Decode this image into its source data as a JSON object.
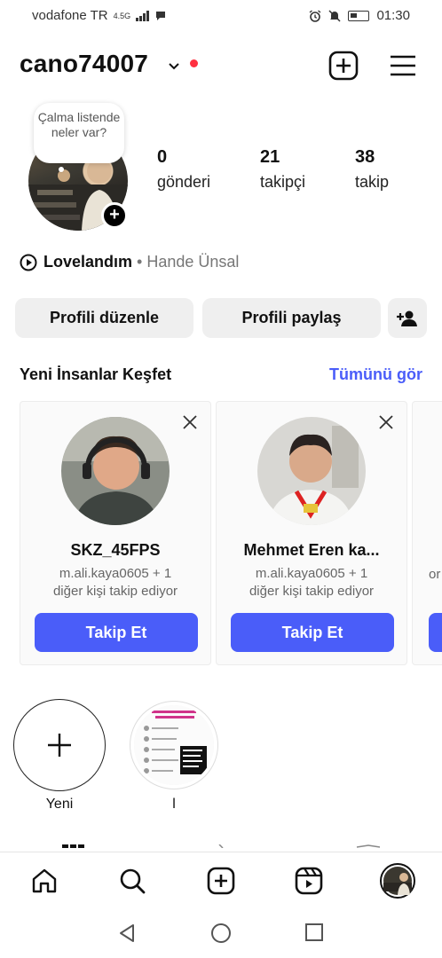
{
  "status_bar": {
    "carrier": "vodafone TR",
    "network": "4.5G",
    "time": "01:30"
  },
  "header": {
    "username": "cano74007",
    "create_icon": "plus-square-icon",
    "menu_icon": "hamburger-menu-icon"
  },
  "profile": {
    "note": "Çalma listende neler var?",
    "stats": [
      {
        "value": "0",
        "label": "gönderi"
      },
      {
        "value": "21",
        "label": "takipçi"
      },
      {
        "value": "38",
        "label": "takip"
      }
    ],
    "music": {
      "song": "Lovelandım",
      "separator": "•",
      "artist": "Hande Ünsal"
    },
    "buttons": {
      "edit": "Profili düzenle",
      "share": "Profili paylaş"
    }
  },
  "discover": {
    "title": "Yeni İnsanlar Keşfet",
    "see_all": "Tümünü gör",
    "cards": [
      {
        "name": "SKZ_45FPS",
        "sub": "m.ali.kaya0605 + 1 diğer kişi takip ediyor",
        "follow": "Takip Et"
      },
      {
        "name": "Mehmet Eren ka...",
        "sub": "m.ali.kaya0605 + 1 diğer kişi takip ediyor",
        "follow": "Takip Et"
      }
    ],
    "partial_card_text": "or"
  },
  "highlights": [
    {
      "label": "Yeni"
    },
    {
      "label": "l"
    }
  ],
  "colors": {
    "accent": "#4a5df9",
    "notification_dot": "#ff3040",
    "button_gray": "#efefef"
  }
}
